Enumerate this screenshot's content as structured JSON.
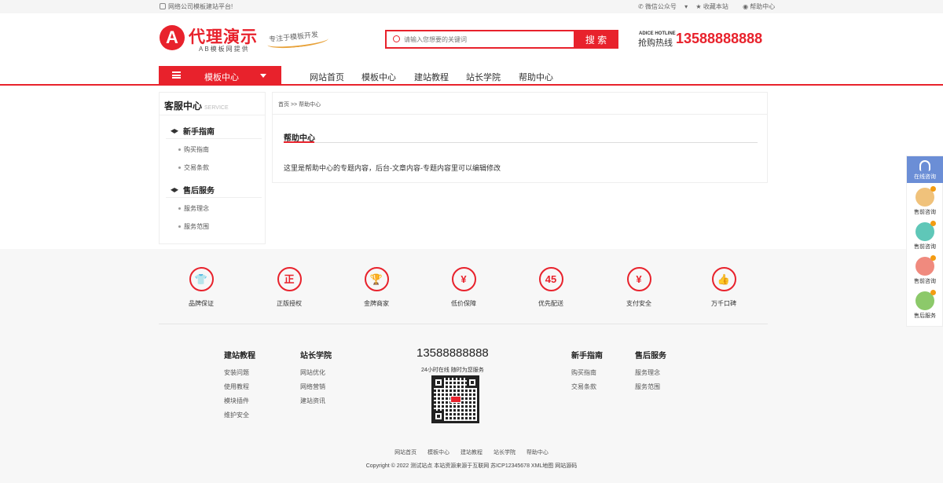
{
  "topbar": {
    "welcome": "网络公司模板建站平台!",
    "wechat": "微信公众号",
    "favorite": "收藏本站",
    "help": "帮助中心"
  },
  "header": {
    "logo_letter": "A",
    "brand": "代理演示",
    "brand_sub": "AB模板网提供",
    "slogan": "专注于模板开发",
    "search_placeholder": "请输入您想要的关键词",
    "search_button": "搜 索",
    "hotline_en": "ADICE HOTLINE",
    "hotline_label": "抢购热线",
    "hotline_number": "13588888888"
  },
  "nav": {
    "category_button": "模板中心",
    "items": [
      "网站首页",
      "模板中心",
      "建站教程",
      "站长学院",
      "帮助中心"
    ]
  },
  "sidebar": {
    "title": "客服中心",
    "title_en": "SERVICE",
    "groups": [
      {
        "heading": "新手指南",
        "items": [
          "购买指南",
          "交易条款"
        ]
      },
      {
        "heading": "售后服务",
        "items": [
          "服务理念",
          "服务范围"
        ]
      }
    ]
  },
  "content": {
    "breadcrumb": "首页 >> 帮助中心",
    "title": "帮助中心",
    "body": "这里是帮助中心的专题内容，后台-文章内容-专题内容里可以编辑修改"
  },
  "features": [
    {
      "icon": "shirt-icon",
      "glyph": "👕",
      "label": "品牌保证"
    },
    {
      "icon": "genuine-icon",
      "glyph": "正",
      "label": "正版授权"
    },
    {
      "icon": "trophy-icon",
      "glyph": "🏆",
      "label": "金牌商家"
    },
    {
      "icon": "price-icon",
      "glyph": "¥",
      "label": "低价保障"
    },
    {
      "icon": "delivery-icon",
      "glyph": "45",
      "label": "优先配送"
    },
    {
      "icon": "payment-icon",
      "glyph": "¥",
      "label": "支付安全"
    },
    {
      "icon": "thumbs-up-icon",
      "glyph": "👍",
      "label": "万千口碑"
    }
  ],
  "footer": {
    "columns": [
      {
        "heading": "建站教程",
        "links": [
          "安装问题",
          "使用教程",
          "模块插件",
          "维护安全"
        ]
      },
      {
        "heading": "站长学院",
        "links": [
          "网站优化",
          "网络营销",
          "建站资讯"
        ]
      },
      {
        "heading": "新手指南",
        "links": [
          "购买指南",
          "交易条款"
        ]
      },
      {
        "heading": "售后服务",
        "links": [
          "服务理念",
          "服务范围"
        ]
      }
    ],
    "phone": "13588888888",
    "phone_sub": "24小时在线 随时为您服务",
    "links": [
      "网站首页",
      "模板中心",
      "建站教程",
      "站长学院",
      "帮助中心"
    ],
    "copyright": "Copyright © 2022 测试站点 本站资源来源于互联网 苏ICP12345678 XML地图 网站源码"
  },
  "float_panel": {
    "top": "在线咨询",
    "items": [
      {
        "label": "售前咨询",
        "color": "#f0c27b"
      },
      {
        "label": "售前咨询",
        "color": "#5fc7b8"
      },
      {
        "label": "售前咨询",
        "color": "#f08a7e"
      },
      {
        "label": "售后服务",
        "color": "#8cc96a"
      }
    ]
  },
  "colors": {
    "accent": "#e8222c",
    "panel_blue": "#6b8ed6"
  }
}
